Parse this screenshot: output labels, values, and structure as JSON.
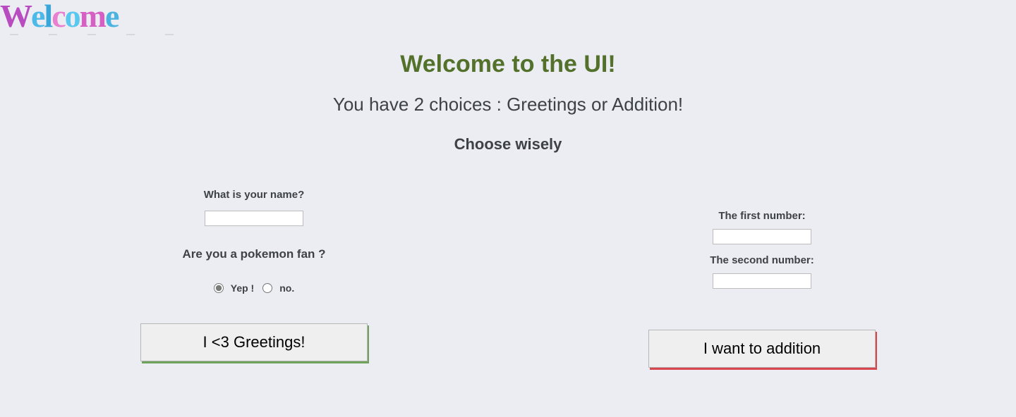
{
  "logo_text": "Welcome",
  "header": {
    "title": "Welcome to the UI!",
    "subtitle": "You have 2 choices : Greetings or Addition!",
    "tagline": "Choose wisely"
  },
  "greetings": {
    "name_label": "What is your name?",
    "name_value": "",
    "fan_question": "Are you a pokemon fan ?",
    "radio_yes": "Yep !",
    "radio_no": "no.",
    "button_label": "I <3 Greetings!"
  },
  "addition": {
    "first_label": "The first number:",
    "first_value": "",
    "second_label": "The second number:",
    "second_value": "",
    "button_label": "I want to addition"
  }
}
